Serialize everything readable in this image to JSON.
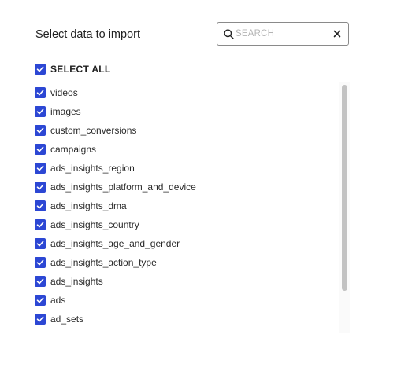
{
  "title": "Select data to import",
  "search": {
    "placeholder": "SEARCH",
    "value": "",
    "icon": "search-icon",
    "clear_icon": "close-icon"
  },
  "select_all": {
    "label": "SELECT ALL",
    "checked": true
  },
  "accent_color": "#2c47d4",
  "streams": [
    {
      "label": "videos",
      "checked": true
    },
    {
      "label": "images",
      "checked": true
    },
    {
      "label": "custom_conversions",
      "checked": true
    },
    {
      "label": "campaigns",
      "checked": true
    },
    {
      "label": "ads_insights_region",
      "checked": true
    },
    {
      "label": "ads_insights_platform_and_device",
      "checked": true
    },
    {
      "label": "ads_insights_dma",
      "checked": true
    },
    {
      "label": "ads_insights_country",
      "checked": true
    },
    {
      "label": "ads_insights_age_and_gender",
      "checked": true
    },
    {
      "label": "ads_insights_action_type",
      "checked": true
    },
    {
      "label": "ads_insights",
      "checked": true
    },
    {
      "label": "ads",
      "checked": true
    },
    {
      "label": "ad_sets",
      "checked": true
    }
  ]
}
